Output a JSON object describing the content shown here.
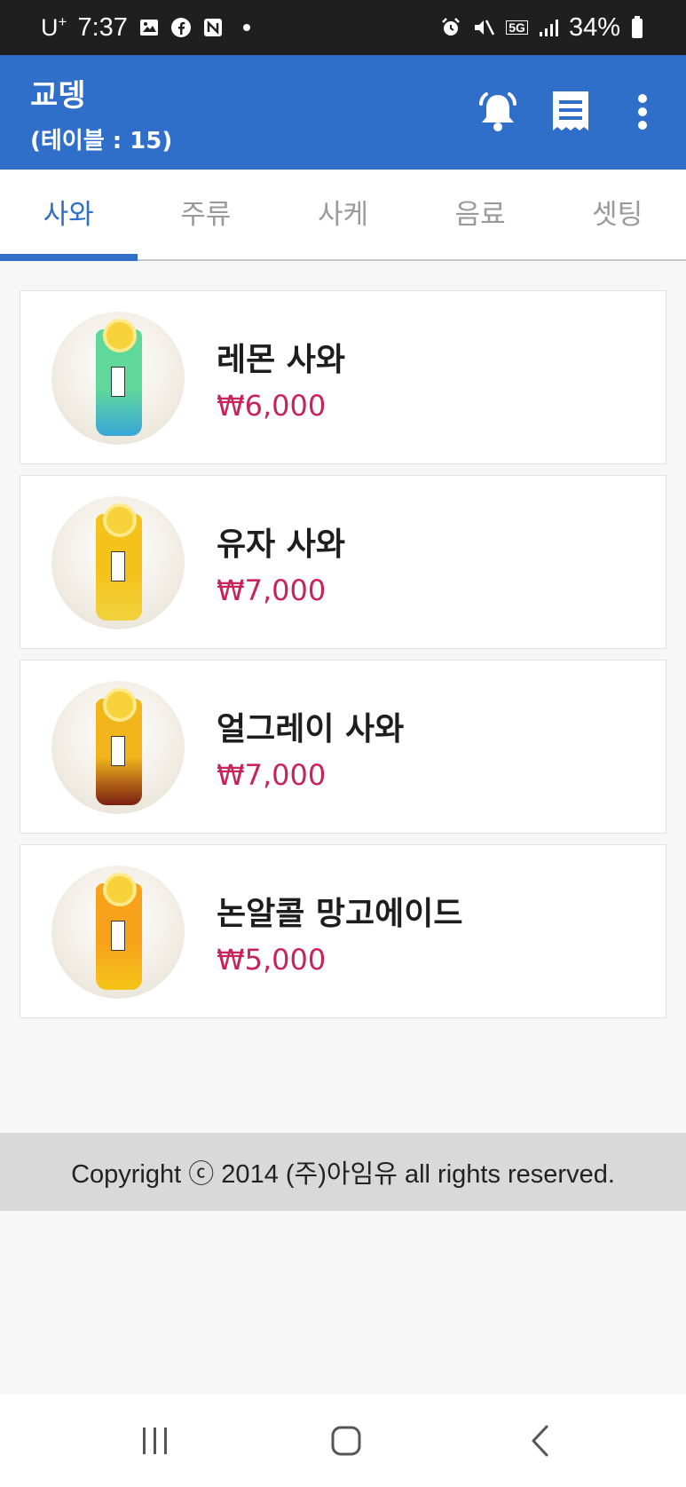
{
  "status_bar": {
    "carrier": "U",
    "carrier_sup": "+",
    "time": "7:37",
    "battery": "34%",
    "network": "5G"
  },
  "app_bar": {
    "store_name": "교뎅",
    "table_label": "(테이블 : 15)",
    "icons": [
      "bell-icon",
      "receipt-icon",
      "more-vertical-icon"
    ]
  },
  "tabs": [
    {
      "label": "사와",
      "active": true
    },
    {
      "label": "주류",
      "active": false
    },
    {
      "label": "사케",
      "active": false
    },
    {
      "label": "음료",
      "active": false
    },
    {
      "label": "셋팅",
      "active": false
    }
  ],
  "menu_items": [
    {
      "name": "레몬 사와",
      "price": "₩6,000",
      "drink_color": "#5fd89a",
      "drink_color_bottom": "#3aa7d8"
    },
    {
      "name": "유자 사와",
      "price": "₩7,000",
      "drink_color": "#f5c21b",
      "drink_color_bottom": "#f0d23c"
    },
    {
      "name": "얼그레이 사와",
      "price": "₩7,000",
      "drink_color": "#f2b51c",
      "drink_color_bottom": "#7a1e12"
    },
    {
      "name": "논알콜 망고에이드",
      "price": "₩5,000",
      "drink_color": "#f7a21a",
      "drink_color_bottom": "#f5c419"
    }
  ],
  "footer": {
    "text": "Copyright ⓒ 2014 (주)아임유 all rights reserved."
  },
  "colors": {
    "primary": "#2f6fca",
    "price": "#c7245b"
  }
}
